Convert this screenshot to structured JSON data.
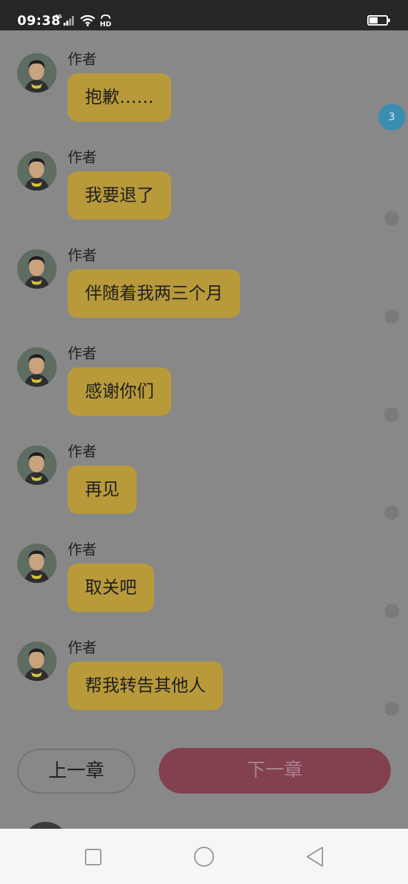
{
  "status_bar": {
    "time": "09:38",
    "network_label": "4G",
    "hd_label": "HD",
    "battery_level": 0.45
  },
  "messages": [
    {
      "sender": "作者",
      "text": "抱歉……"
    },
    {
      "sender": "作者",
      "text": "我要退了"
    },
    {
      "sender": "作者",
      "text": "伴随着我两三个月"
    },
    {
      "sender": "作者",
      "text": "感谢你们"
    },
    {
      "sender": "作者",
      "text": "再见"
    },
    {
      "sender": "作者",
      "text": "取关吧"
    },
    {
      "sender": "作者",
      "text": "帮我转告其他人"
    }
  ],
  "unread_badge": "3",
  "chapter_nav": {
    "prev_label": "上一章",
    "next_label": "下一章"
  },
  "colors": {
    "bubble": "#b89a3a",
    "next_button": "#83404e",
    "badge": "#3b8db0",
    "overlay_background": "#888888"
  }
}
